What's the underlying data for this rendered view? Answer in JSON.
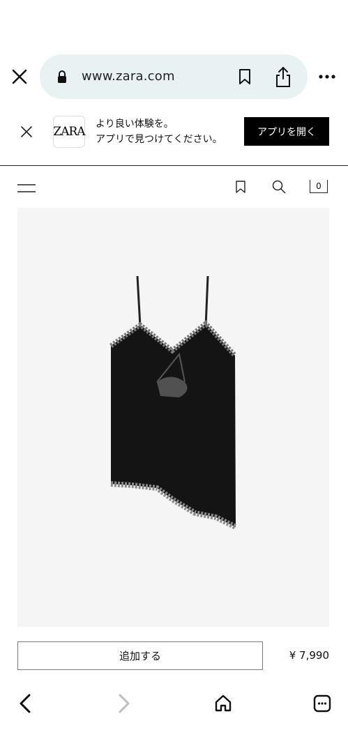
{
  "browser": {
    "url": "www.zara.com",
    "icons": [
      "close-icon",
      "lock-icon",
      "bookmark-icon",
      "share-icon",
      "more-icon"
    ]
  },
  "app_banner": {
    "line1": "より良い体験を。",
    "line2": "アプリで見つけてください。",
    "logo_text": "ZARA",
    "open_button": "アプリを開く"
  },
  "header": {
    "cart_count": "0",
    "icons": [
      "menu-icon",
      "bookmark-icon",
      "search-icon",
      "cart-icon"
    ]
  },
  "product": {
    "add_button": "追加する",
    "price": "¥ 7,990"
  },
  "toolbar": {
    "icons": [
      "back-icon",
      "forward-icon",
      "home-icon",
      "tabs-icon"
    ]
  }
}
